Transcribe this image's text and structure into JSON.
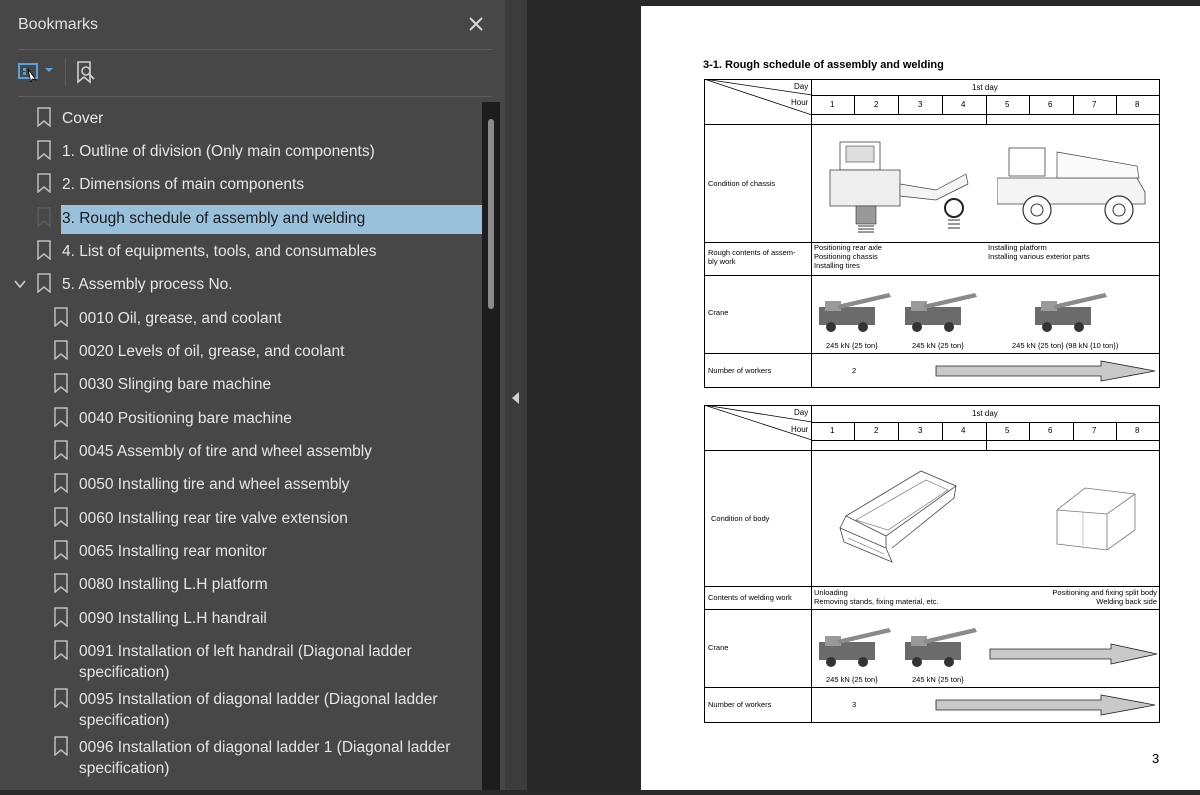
{
  "sidebar": {
    "title": "Bookmarks",
    "close_icon": "close-icon",
    "toolbar": {
      "options_icon": "bookmark-options-icon",
      "find_icon": "find-bookmark-icon"
    },
    "items": [
      {
        "label": "Cover",
        "indent": 0,
        "expanded": null
      },
      {
        "label": "1. Outline of division (Only main components)",
        "indent": 0
      },
      {
        "label": "2. Dimensions of main components",
        "indent": 0
      },
      {
        "label": "3. Rough schedule of assembly and welding",
        "indent": 0,
        "selected": true
      },
      {
        "label": "4. List of equipments, tools, and consumables",
        "indent": 0
      },
      {
        "label": "5. Assembly process No.",
        "indent": 0,
        "expanded": true
      },
      {
        "label": "0010 Oil, grease, and coolant",
        "indent": 1
      },
      {
        "label": "0020 Levels of oil, grease, and coolant",
        "indent": 1
      },
      {
        "label": "0030 Slinging bare machine",
        "indent": 1
      },
      {
        "label": "0040 Positioning bare machine",
        "indent": 1
      },
      {
        "label": "0045 Assembly of tire and wheel assembly",
        "indent": 1
      },
      {
        "label": "0050 Installing tire and wheel assembly",
        "indent": 1
      },
      {
        "label": "0060 Installing rear tire valve extension",
        "indent": 1
      },
      {
        "label": "0065 Installing rear monitor",
        "indent": 1
      },
      {
        "label": "0080 Installing L.H platform",
        "indent": 1
      },
      {
        "label": "0090 Installing L.H handrail",
        "indent": 1
      },
      {
        "label": "0091 Installation of left handrail (Diagonal ladder specification)",
        "indent": 1,
        "line1": "0091 Installation of left handrail (Diagonal ladder",
        "line2": "specification)"
      },
      {
        "label": "0095 Installation of diagonal ladder (Diagonal ladder specification)",
        "indent": 1,
        "line1": "0095 Installation of diagonal ladder (Diagonal ladder",
        "line2": "specification)"
      },
      {
        "label": "0096 Installation of diagonal ladder 1 (Diagonal ladder specification)",
        "indent": 1,
        "line1": "0096 Installation of diagonal ladder 1 (Diagonal ladder",
        "line2": "specification)"
      }
    ]
  },
  "document": {
    "section_title": "3-1.  Rough schedule of assembly and welding",
    "page_number": "3",
    "table1": {
      "day_label": "Day",
      "hour_label": "Hour",
      "day_value": "1st day",
      "hours": [
        "1",
        "2",
        "3",
        "4",
        "5",
        "6",
        "7",
        "8"
      ],
      "row_chassis": "Condition of chassis",
      "row_assembly_line1": "Rough contents of assem-",
      "row_assembly_line2": "bly work",
      "assembly_left": [
        "Positioning rear axle",
        "Positioning chassis",
        "Installing tires"
      ],
      "assembly_right": [
        "Installing platform",
        "Installing various exterior parts"
      ],
      "row_crane": "Crane",
      "crane_caps": [
        "245 kN {25 ton}",
        "245 kN {25 ton}",
        "245 kN {25 ton} (98 kN {10 ton})"
      ],
      "row_workers": "Number of workers",
      "workers": "2"
    },
    "table2": {
      "day_label": "Day",
      "hour_label": "Hour",
      "day_value": "1st day",
      "hours": [
        "1",
        "2",
        "3",
        "4",
        "5",
        "6",
        "7",
        "8"
      ],
      "row_body": "Condition of body",
      "row_welding": "Contents of welding work",
      "welding_left": [
        "Unloading",
        "Removing stands, fixing material, etc."
      ],
      "welding_right": [
        "Positioning and fixing split body",
        "Welding back side"
      ],
      "row_crane": "Crane",
      "crane_caps": [
        "245 kN {25 ton}",
        "245 kN {25 ton}"
      ],
      "row_workers": "Number of workers",
      "workers": "3"
    }
  },
  "colors": {
    "sidebar_bg": "#474747",
    "selected_bg": "#99c1dc",
    "viewer_bg": "#282828"
  }
}
